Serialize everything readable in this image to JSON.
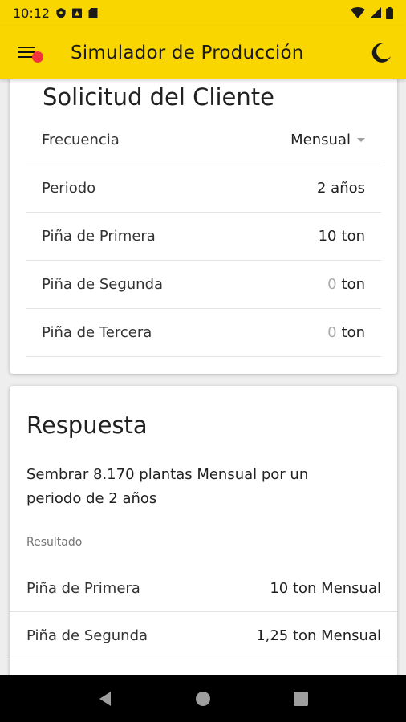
{
  "status_bar": {
    "time": "10:12"
  },
  "app_bar": {
    "title": "Simulador de Producción"
  },
  "request_card": {
    "title": "Solicitud del Cliente",
    "rows": [
      {
        "label": "Frecuencia",
        "value": "Mensual",
        "type": "dropdown"
      },
      {
        "label": "Periodo",
        "value": "2 años"
      },
      {
        "label": "Piña de Primera",
        "value": "10",
        "unit": "ton"
      },
      {
        "label": "Piña de Segunda",
        "value": "0",
        "unit": "ton"
      },
      {
        "label": "Piña de Tercera",
        "value": "0",
        "unit": "ton"
      }
    ]
  },
  "response_card": {
    "title": "Respuesta",
    "summary": "Sembrar 8.170 plantas Mensual por un periodo de 2 años",
    "caption": "Resultado",
    "rows": [
      {
        "label": "Piña de Primera",
        "value": "10 ton Mensual"
      },
      {
        "label": "Piña de Segunda",
        "value": "1,25 ton Mensual"
      }
    ]
  },
  "colors": {
    "accent": "#f9d600",
    "notification_dot": "#f5333f"
  }
}
